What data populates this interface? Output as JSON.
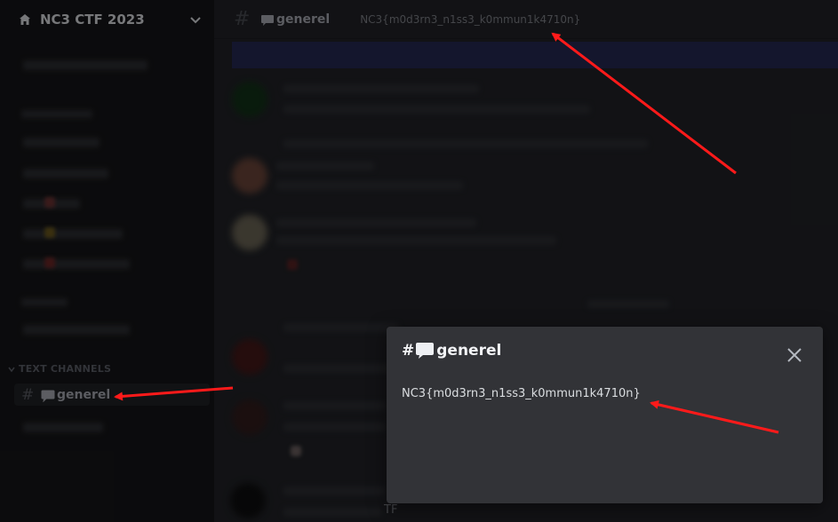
{
  "server": {
    "name": "NC3 CTF 2023",
    "icon": "home-icon",
    "chevron": "chevron-down-icon"
  },
  "sidebar": {
    "category_label": "TEXT CHANNELS",
    "active_channel": "generel"
  },
  "channel": {
    "name": "generel",
    "topic": "NC3{m0d3rn3_n1ss3_k0mmun1k4710n}"
  },
  "modal": {
    "title": "generel",
    "topic": "NC3{m0d3rn3_n1ss3_k0mmun1k4710n}",
    "close_icon": "close-icon"
  },
  "chat": {
    "partial_text": "TF"
  },
  "colors": {
    "annotation_arrow": "#ff1a1a",
    "modal_bg": "#323337",
    "banner": "#1f2346"
  }
}
